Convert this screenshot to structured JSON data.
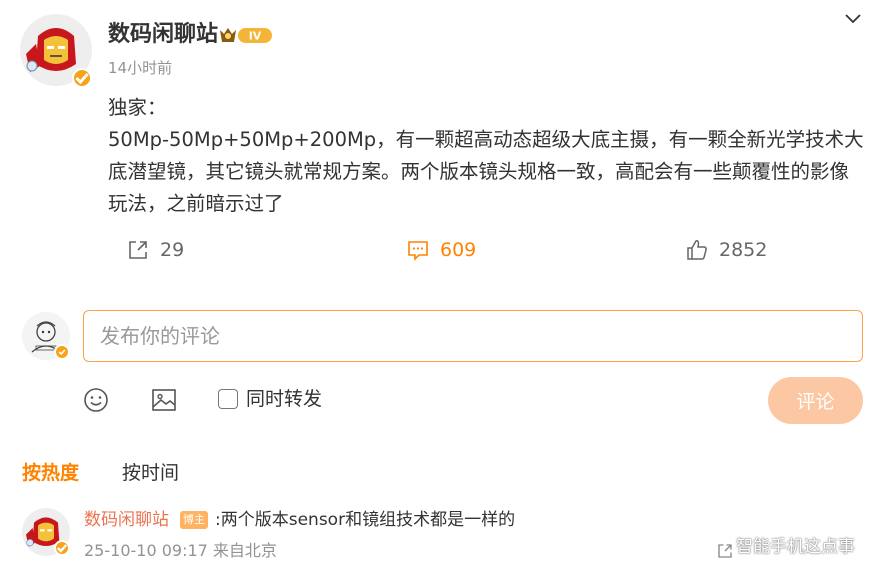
{
  "post": {
    "author": "数码闲聊站",
    "time": "14小时前",
    "text": "独家：\n50Mp-50Mp+50Mp+200Mp，有一颗超高动态超级大底主摄，有一颗全新光学技术大底潜望镜，其它镜头就常规方案。两个版本镜头规格一致，高配会有一些颠覆性的影像玩法，之前暗示过了",
    "level_badge": "IV",
    "share_count": "29",
    "comment_count": "609",
    "like_count": "2852"
  },
  "composer": {
    "placeholder": "发布你的评论",
    "repost_label": "同时转发",
    "submit_label": "评论"
  },
  "sort": {
    "hot_label": "按热度",
    "time_label": "按时间"
  },
  "comments": [
    {
      "author": "数码闲聊站",
      "badge": "博主",
      "text": ":两个版本sensor和镜组技术都是一样的",
      "meta": "25-10-10 09:17 来自北京"
    }
  ],
  "watermark": "智能手机这点事",
  "icons": {
    "chevron": "chevron-down-icon",
    "share": "share-icon",
    "comment": "comment-icon",
    "like": "thumbs-up-icon",
    "emoji": "emoji-icon",
    "image": "image-icon"
  },
  "colors": {
    "accent": "#ff8200",
    "author_comment": "#eb7350",
    "submit_disabled": "#fcc8a4",
    "input_border": "#ffa04a",
    "muted": "#939393"
  }
}
